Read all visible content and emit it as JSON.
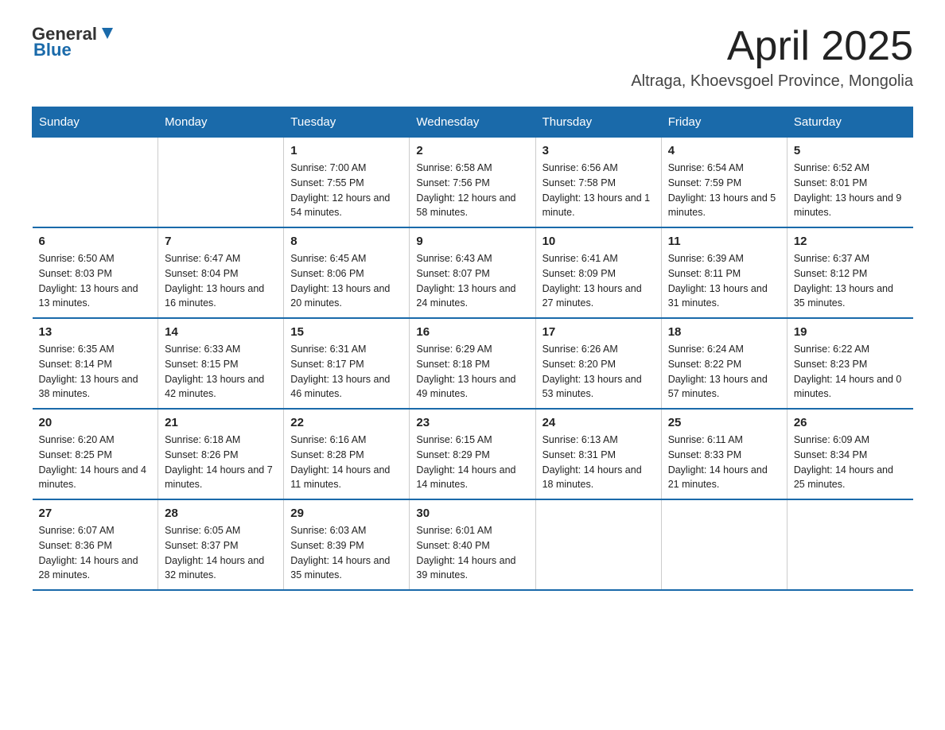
{
  "logo": {
    "text_general": "General",
    "text_blue": "Blue"
  },
  "header": {
    "title": "April 2025",
    "subtitle": "Altraga, Khoevsgoel Province, Mongolia"
  },
  "days_of_week": [
    "Sunday",
    "Monday",
    "Tuesday",
    "Wednesday",
    "Thursday",
    "Friday",
    "Saturday"
  ],
  "weeks": [
    [
      {
        "day": "",
        "sunrise": "",
        "sunset": "",
        "daylight": ""
      },
      {
        "day": "",
        "sunrise": "",
        "sunset": "",
        "daylight": ""
      },
      {
        "day": "1",
        "sunrise": "Sunrise: 7:00 AM",
        "sunset": "Sunset: 7:55 PM",
        "daylight": "Daylight: 12 hours and 54 minutes."
      },
      {
        "day": "2",
        "sunrise": "Sunrise: 6:58 AM",
        "sunset": "Sunset: 7:56 PM",
        "daylight": "Daylight: 12 hours and 58 minutes."
      },
      {
        "day": "3",
        "sunrise": "Sunrise: 6:56 AM",
        "sunset": "Sunset: 7:58 PM",
        "daylight": "Daylight: 13 hours and 1 minute."
      },
      {
        "day": "4",
        "sunrise": "Sunrise: 6:54 AM",
        "sunset": "Sunset: 7:59 PM",
        "daylight": "Daylight: 13 hours and 5 minutes."
      },
      {
        "day": "5",
        "sunrise": "Sunrise: 6:52 AM",
        "sunset": "Sunset: 8:01 PM",
        "daylight": "Daylight: 13 hours and 9 minutes."
      }
    ],
    [
      {
        "day": "6",
        "sunrise": "Sunrise: 6:50 AM",
        "sunset": "Sunset: 8:03 PM",
        "daylight": "Daylight: 13 hours and 13 minutes."
      },
      {
        "day": "7",
        "sunrise": "Sunrise: 6:47 AM",
        "sunset": "Sunset: 8:04 PM",
        "daylight": "Daylight: 13 hours and 16 minutes."
      },
      {
        "day": "8",
        "sunrise": "Sunrise: 6:45 AM",
        "sunset": "Sunset: 8:06 PM",
        "daylight": "Daylight: 13 hours and 20 minutes."
      },
      {
        "day": "9",
        "sunrise": "Sunrise: 6:43 AM",
        "sunset": "Sunset: 8:07 PM",
        "daylight": "Daylight: 13 hours and 24 minutes."
      },
      {
        "day": "10",
        "sunrise": "Sunrise: 6:41 AM",
        "sunset": "Sunset: 8:09 PM",
        "daylight": "Daylight: 13 hours and 27 minutes."
      },
      {
        "day": "11",
        "sunrise": "Sunrise: 6:39 AM",
        "sunset": "Sunset: 8:11 PM",
        "daylight": "Daylight: 13 hours and 31 minutes."
      },
      {
        "day": "12",
        "sunrise": "Sunrise: 6:37 AM",
        "sunset": "Sunset: 8:12 PM",
        "daylight": "Daylight: 13 hours and 35 minutes."
      }
    ],
    [
      {
        "day": "13",
        "sunrise": "Sunrise: 6:35 AM",
        "sunset": "Sunset: 8:14 PM",
        "daylight": "Daylight: 13 hours and 38 minutes."
      },
      {
        "day": "14",
        "sunrise": "Sunrise: 6:33 AM",
        "sunset": "Sunset: 8:15 PM",
        "daylight": "Daylight: 13 hours and 42 minutes."
      },
      {
        "day": "15",
        "sunrise": "Sunrise: 6:31 AM",
        "sunset": "Sunset: 8:17 PM",
        "daylight": "Daylight: 13 hours and 46 minutes."
      },
      {
        "day": "16",
        "sunrise": "Sunrise: 6:29 AM",
        "sunset": "Sunset: 8:18 PM",
        "daylight": "Daylight: 13 hours and 49 minutes."
      },
      {
        "day": "17",
        "sunrise": "Sunrise: 6:26 AM",
        "sunset": "Sunset: 8:20 PM",
        "daylight": "Daylight: 13 hours and 53 minutes."
      },
      {
        "day": "18",
        "sunrise": "Sunrise: 6:24 AM",
        "sunset": "Sunset: 8:22 PM",
        "daylight": "Daylight: 13 hours and 57 minutes."
      },
      {
        "day": "19",
        "sunrise": "Sunrise: 6:22 AM",
        "sunset": "Sunset: 8:23 PM",
        "daylight": "Daylight: 14 hours and 0 minutes."
      }
    ],
    [
      {
        "day": "20",
        "sunrise": "Sunrise: 6:20 AM",
        "sunset": "Sunset: 8:25 PM",
        "daylight": "Daylight: 14 hours and 4 minutes."
      },
      {
        "day": "21",
        "sunrise": "Sunrise: 6:18 AM",
        "sunset": "Sunset: 8:26 PM",
        "daylight": "Daylight: 14 hours and 7 minutes."
      },
      {
        "day": "22",
        "sunrise": "Sunrise: 6:16 AM",
        "sunset": "Sunset: 8:28 PM",
        "daylight": "Daylight: 14 hours and 11 minutes."
      },
      {
        "day": "23",
        "sunrise": "Sunrise: 6:15 AM",
        "sunset": "Sunset: 8:29 PM",
        "daylight": "Daylight: 14 hours and 14 minutes."
      },
      {
        "day": "24",
        "sunrise": "Sunrise: 6:13 AM",
        "sunset": "Sunset: 8:31 PM",
        "daylight": "Daylight: 14 hours and 18 minutes."
      },
      {
        "day": "25",
        "sunrise": "Sunrise: 6:11 AM",
        "sunset": "Sunset: 8:33 PM",
        "daylight": "Daylight: 14 hours and 21 minutes."
      },
      {
        "day": "26",
        "sunrise": "Sunrise: 6:09 AM",
        "sunset": "Sunset: 8:34 PM",
        "daylight": "Daylight: 14 hours and 25 minutes."
      }
    ],
    [
      {
        "day": "27",
        "sunrise": "Sunrise: 6:07 AM",
        "sunset": "Sunset: 8:36 PM",
        "daylight": "Daylight: 14 hours and 28 minutes."
      },
      {
        "day": "28",
        "sunrise": "Sunrise: 6:05 AM",
        "sunset": "Sunset: 8:37 PM",
        "daylight": "Daylight: 14 hours and 32 minutes."
      },
      {
        "day": "29",
        "sunrise": "Sunrise: 6:03 AM",
        "sunset": "Sunset: 8:39 PM",
        "daylight": "Daylight: 14 hours and 35 minutes."
      },
      {
        "day": "30",
        "sunrise": "Sunrise: 6:01 AM",
        "sunset": "Sunset: 8:40 PM",
        "daylight": "Daylight: 14 hours and 39 minutes."
      },
      {
        "day": "",
        "sunrise": "",
        "sunset": "",
        "daylight": ""
      },
      {
        "day": "",
        "sunrise": "",
        "sunset": "",
        "daylight": ""
      },
      {
        "day": "",
        "sunrise": "",
        "sunset": "",
        "daylight": ""
      }
    ]
  ]
}
